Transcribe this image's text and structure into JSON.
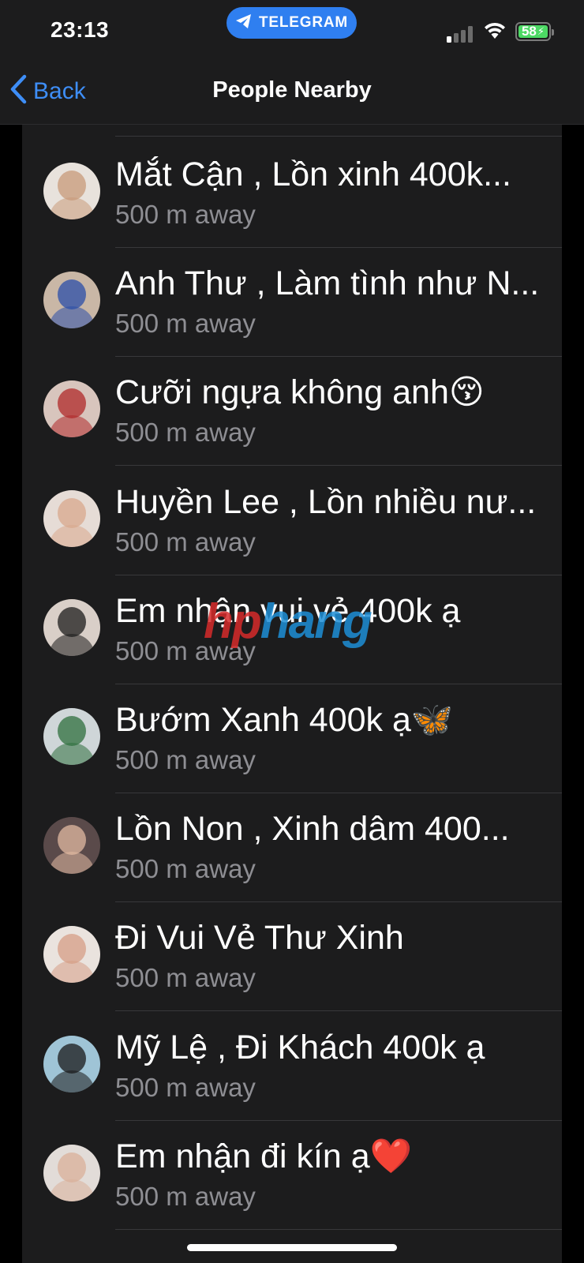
{
  "status_bar": {
    "time": "23:13",
    "app_label": "TELEGRAM",
    "battery": "58",
    "signal_bars_active": 1,
    "signal_bars_total": 4
  },
  "nav": {
    "back_label": "Back",
    "title": "People Nearby"
  },
  "watermark": {
    "part1": "hp",
    "part2": "hang"
  },
  "colors": {
    "accent": "#3e8ef7",
    "pill": "#2f7ff0",
    "battery": "#4cd964",
    "panel": "#1c1c1d",
    "secondary_text": "#8e8e93"
  },
  "people": [
    {
      "name": "Mắt Cận , Lồn xinh 400k...",
      "distance": "500 m away",
      "avatar_bg": "#e8e2dc",
      "avatar_fg": "#c89a7a"
    },
    {
      "name": "Anh Thư , Làm tình như N...",
      "distance": "500 m away",
      "avatar_bg": "#c9b7a6",
      "avatar_fg": "#2a4ea8"
    },
    {
      "name": "Cưỡi ngựa không anh😚",
      "distance": "500 m away",
      "avatar_bg": "#d8c5bd",
      "avatar_fg": "#b0282a"
    },
    {
      "name": "Huyền Lee , Lồn nhiều nư...",
      "distance": "500 m away",
      "avatar_bg": "#e6dcd6",
      "avatar_fg": "#d8a88c"
    },
    {
      "name": "Em nhận vui vẻ 400k ạ",
      "distance": "500 m away",
      "avatar_bg": "#d9cfc8",
      "avatar_fg": "#1c1c1c"
    },
    {
      "name": "Bướm Xanh 400k ạ🦋",
      "distance": "500 m away",
      "avatar_bg": "#cfd6d8",
      "avatar_fg": "#2f6f3e"
    },
    {
      "name": "Lồn Non , Xinh dâm 400...",
      "distance": "500 m away",
      "avatar_bg": "#5a4a4a",
      "avatar_fg": "#e2b9a2"
    },
    {
      "name": "Đi Vui Vẻ Thư Xinh",
      "distance": "500 m away",
      "avatar_bg": "#eae3de",
      "avatar_fg": "#d59e86"
    },
    {
      "name": "Mỹ Lệ , Đi Khách 400k ạ",
      "distance": "500 m away",
      "avatar_bg": "#9fc4d6",
      "avatar_fg": "#1a1a1a"
    },
    {
      "name": "Em nhận đi kín ạ❤️",
      "distance": "500 m away",
      "avatar_bg": "#e2dcd8",
      "avatar_fg": "#d9b09a"
    }
  ]
}
